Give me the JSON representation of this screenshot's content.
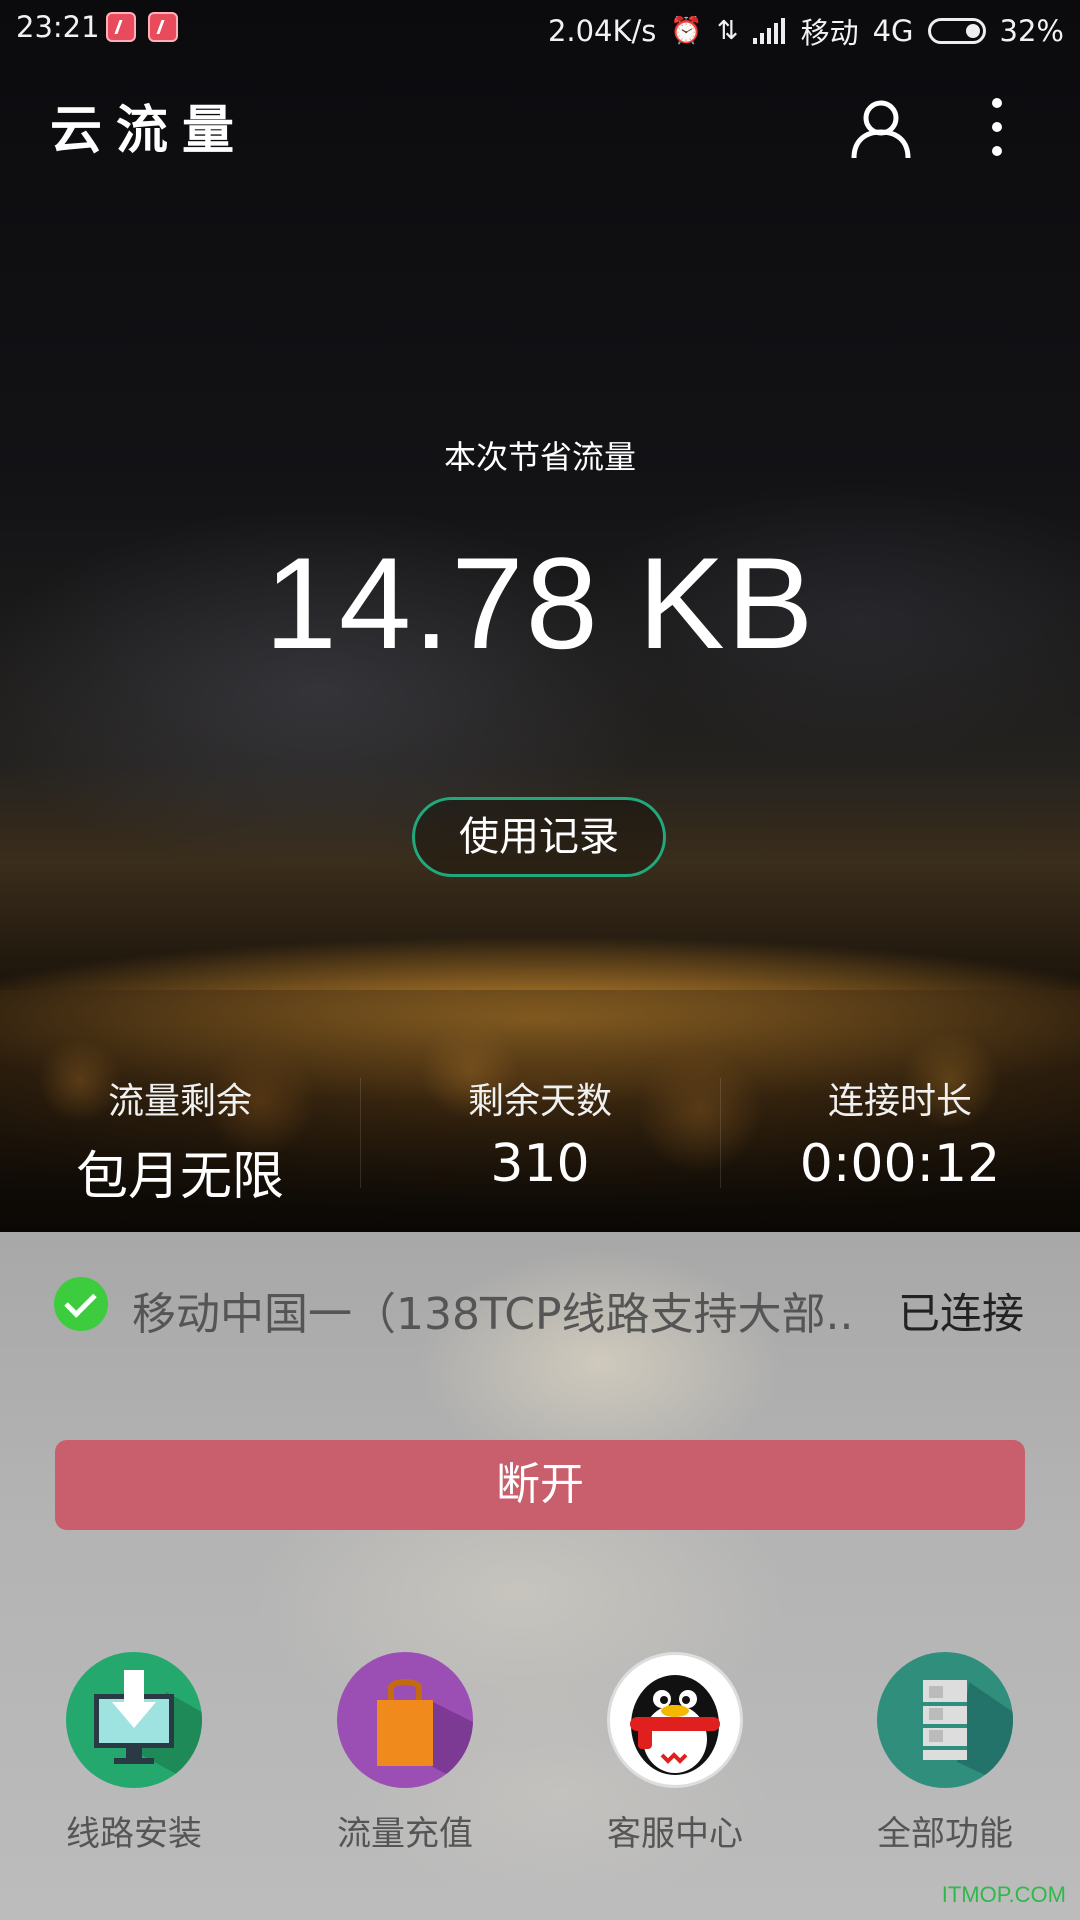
{
  "status_bar": {
    "time": "23:21",
    "net_speed": "2.04K/s",
    "carrier": "移动",
    "network": "4G",
    "battery": "32%",
    "battery_level": 0.32
  },
  "app_bar": {
    "title": "云流量",
    "icons": [
      "user-icon",
      "more-vert-icon"
    ]
  },
  "summary": {
    "saved_label": "本次节省流量",
    "saved_value": "14.78 KB",
    "history_button": "使用记录"
  },
  "stats": [
    {
      "label": "流量剩余",
      "value": "包月无限"
    },
    {
      "label": "剩余天数",
      "value": "310"
    },
    {
      "label": "连接时长",
      "value": "0:00:12"
    }
  ],
  "connection": {
    "line_name": "移动中国一（138TCP线路支持大部..",
    "status": "已连接",
    "disconnect_button": "断开"
  },
  "features": [
    {
      "label": "线路安装",
      "icon": "install-monitor-icon"
    },
    {
      "label": "流量充值",
      "icon": "shopping-bag-icon"
    },
    {
      "label": "客服中心",
      "icon": "qq-penguin-icon"
    },
    {
      "label": "全部功能",
      "icon": "server-stack-icon"
    }
  ],
  "watermark": "ITMOP.COM",
  "colors": {
    "accent_green": "#1fa97d",
    "disconnect_red": "#c95e6c",
    "check_green": "#3ccc3e"
  }
}
